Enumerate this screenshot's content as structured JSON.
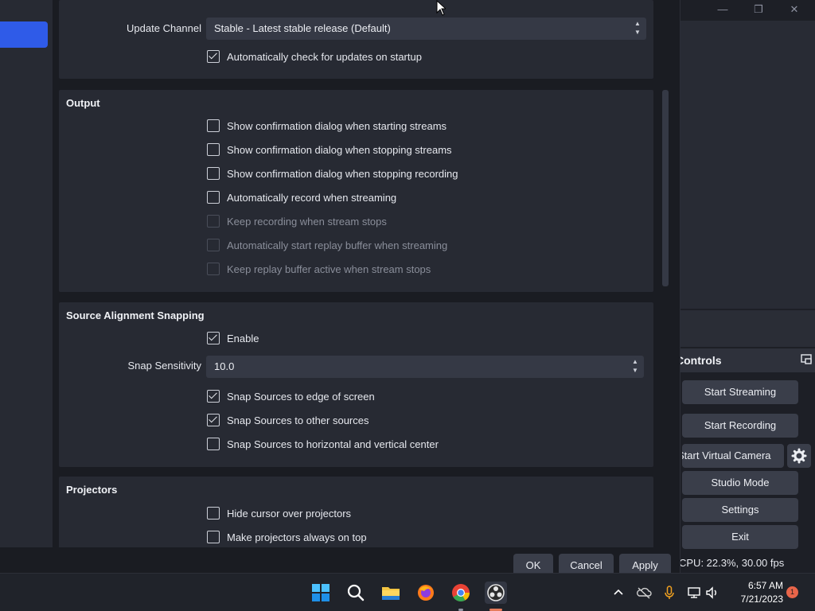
{
  "window_controls": {
    "minimize": "—",
    "maximize": "❐",
    "close": "✕"
  },
  "general": {
    "update_channel_label": "Update Channel",
    "update_channel_value": "Stable - Latest stable release (Default)",
    "auto_check_updates": {
      "label": "Automatically check for updates on startup",
      "checked": true
    }
  },
  "output": {
    "title": "Output",
    "items": [
      {
        "label": "Show confirmation dialog when starting streams",
        "checked": false,
        "enabled": true
      },
      {
        "label": "Show confirmation dialog when stopping streams",
        "checked": false,
        "enabled": true
      },
      {
        "label": "Show confirmation dialog when stopping recording",
        "checked": false,
        "enabled": true
      },
      {
        "label": "Automatically record when streaming",
        "checked": false,
        "enabled": true
      },
      {
        "label": "Keep recording when stream stops",
        "checked": false,
        "enabled": false
      },
      {
        "label": "Automatically start replay buffer when streaming",
        "checked": false,
        "enabled": false
      },
      {
        "label": "Keep replay buffer active when stream stops",
        "checked": false,
        "enabled": false
      }
    ]
  },
  "snapping": {
    "title": "Source Alignment Snapping",
    "enable": {
      "label": "Enable",
      "checked": true
    },
    "sensitivity_label": "Snap Sensitivity",
    "sensitivity_value": "10.0",
    "items": [
      {
        "label": "Snap Sources to edge of screen",
        "checked": true
      },
      {
        "label": "Snap Sources to other sources",
        "checked": true
      },
      {
        "label": "Snap Sources to horizontal and vertical center",
        "checked": false
      }
    ]
  },
  "projectors": {
    "title": "Projectors",
    "items": [
      {
        "label": "Hide cursor over projectors",
        "checked": false
      },
      {
        "label": "Make projectors always on top",
        "checked": false
      }
    ]
  },
  "footer": {
    "ok": "OK",
    "cancel": "Cancel",
    "apply": "Apply"
  },
  "obs_main": {
    "controls_title": "Controls",
    "start_streaming": "Start Streaming",
    "start_recording": "Start Recording",
    "start_virtual_camera": "Start Virtual Camera",
    "studio_mode": "Studio Mode",
    "settings": "Settings",
    "exit": "Exit",
    "status": "CPU: 22.3%, 30.00 fps"
  },
  "taskbar": {
    "apps": [
      "windows-start",
      "search",
      "file-explorer",
      "firefox",
      "chrome",
      "obs-studio"
    ],
    "time": "6:57 AM",
    "date": "7/21/2023",
    "notification_count": "1"
  },
  "colors": {
    "accent": "#2f5be8",
    "panel": "#272a33",
    "background": "#1a1c22",
    "button": "#3a3e4a"
  }
}
